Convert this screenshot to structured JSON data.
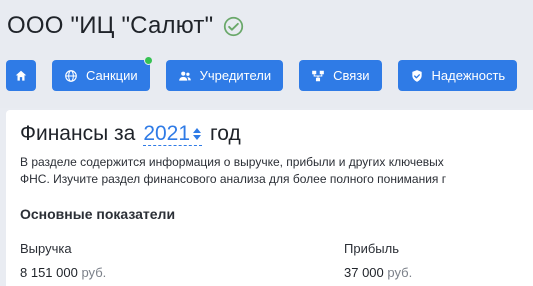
{
  "company": {
    "name": "ООО \"ИЦ \"Салют\"",
    "verified_icon": "check-circle-icon"
  },
  "nav": {
    "home_icon": "home-icon",
    "sanctions_label": "Санкции",
    "sanctions_icon": "globe-icon",
    "founders_label": "Учредители",
    "founders_icon": "users-icon",
    "links_label": "Связи",
    "links_icon": "network-icon",
    "reliability_label": "Надежность",
    "reliability_icon": "shield-check-icon",
    "accent": "#2f7be6",
    "status_dot_color": "#36c253"
  },
  "finance": {
    "title_prefix": "Финансы за",
    "year": "2021",
    "title_suffix": "год",
    "description_line1": "В разделе содержится информация о выручке, прибыли и других ключевых",
    "description_line2": "ФНС. Изучите раздел финансового анализа для более полного понимания г",
    "section_title": "Основные показатели",
    "revenue": {
      "label": "Выручка",
      "value": "8 151 000",
      "unit": "руб."
    },
    "profit": {
      "label": "Прибыль",
      "value": "37 000",
      "unit": "руб."
    }
  }
}
